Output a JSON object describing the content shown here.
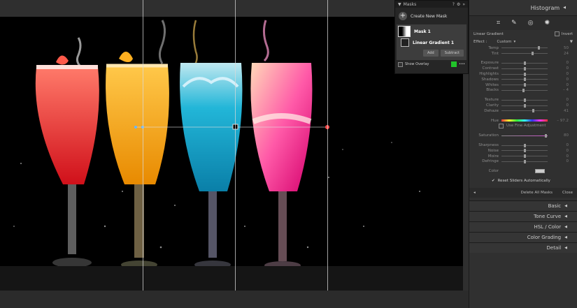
{
  "masks_panel": {
    "title": "Masks",
    "create_label": "Create New Mask",
    "mask1_label": "Mask 1",
    "gradient_label": "Linear Gradient 1",
    "add_label": "Add",
    "subtract_label": "Subtract",
    "show_overlay_label": "Show Overlay",
    "overlay_color": "#21c42a"
  },
  "right_panel": {
    "histogram_label": "Histogram",
    "mask_name": "Linear Gradient",
    "invert_label": "Invert",
    "effect_label": "Effect :",
    "effect_value": "Custom",
    "sliders_group1": [
      {
        "label": "Temp",
        "value": "50",
        "pos": 0.82
      },
      {
        "label": "Tint",
        "value": "24",
        "pos": 0.68
      }
    ],
    "sliders_group2": [
      {
        "label": "Exposure",
        "value": "0",
        "pos": 0.5
      },
      {
        "label": "Contrast",
        "value": "0",
        "pos": 0.5
      },
      {
        "label": "Highlights",
        "value": "0",
        "pos": 0.5
      },
      {
        "label": "Shadows",
        "value": "0",
        "pos": 0.5
      },
      {
        "label": "Whites",
        "value": "0",
        "pos": 0.5
      },
      {
        "label": "Blacks",
        "value": "– 4",
        "pos": 0.48
      }
    ],
    "sliders_group3": [
      {
        "label": "Texture",
        "value": "0",
        "pos": 0.5
      },
      {
        "label": "Clarity",
        "value": "0",
        "pos": 0.5
      },
      {
        "label": "Dehaze",
        "value": "41",
        "pos": 0.7
      }
    ],
    "hue_label": "Hue",
    "hue_value": "– 97.2",
    "fine_adjust_label": "Use Fine Adjustment",
    "saturation_label": "Saturation",
    "saturation_value": "80",
    "sliders_group4": [
      {
        "label": "Sharpness",
        "value": "0",
        "pos": 0.5
      },
      {
        "label": "Noise",
        "value": "0",
        "pos": 0.5
      },
      {
        "label": "Moire",
        "value": "0",
        "pos": 0.5
      },
      {
        "label": "Defringe",
        "value": "0",
        "pos": 0.5
      }
    ],
    "color_label": "Color",
    "reset_label": "Reset Sliders Automatically",
    "delete_all_label": "Delete All Masks",
    "close_label": "Close",
    "sections": [
      "Basic",
      "Tone Curve",
      "HSL / Color",
      "Color Grading",
      "Detail"
    ]
  }
}
